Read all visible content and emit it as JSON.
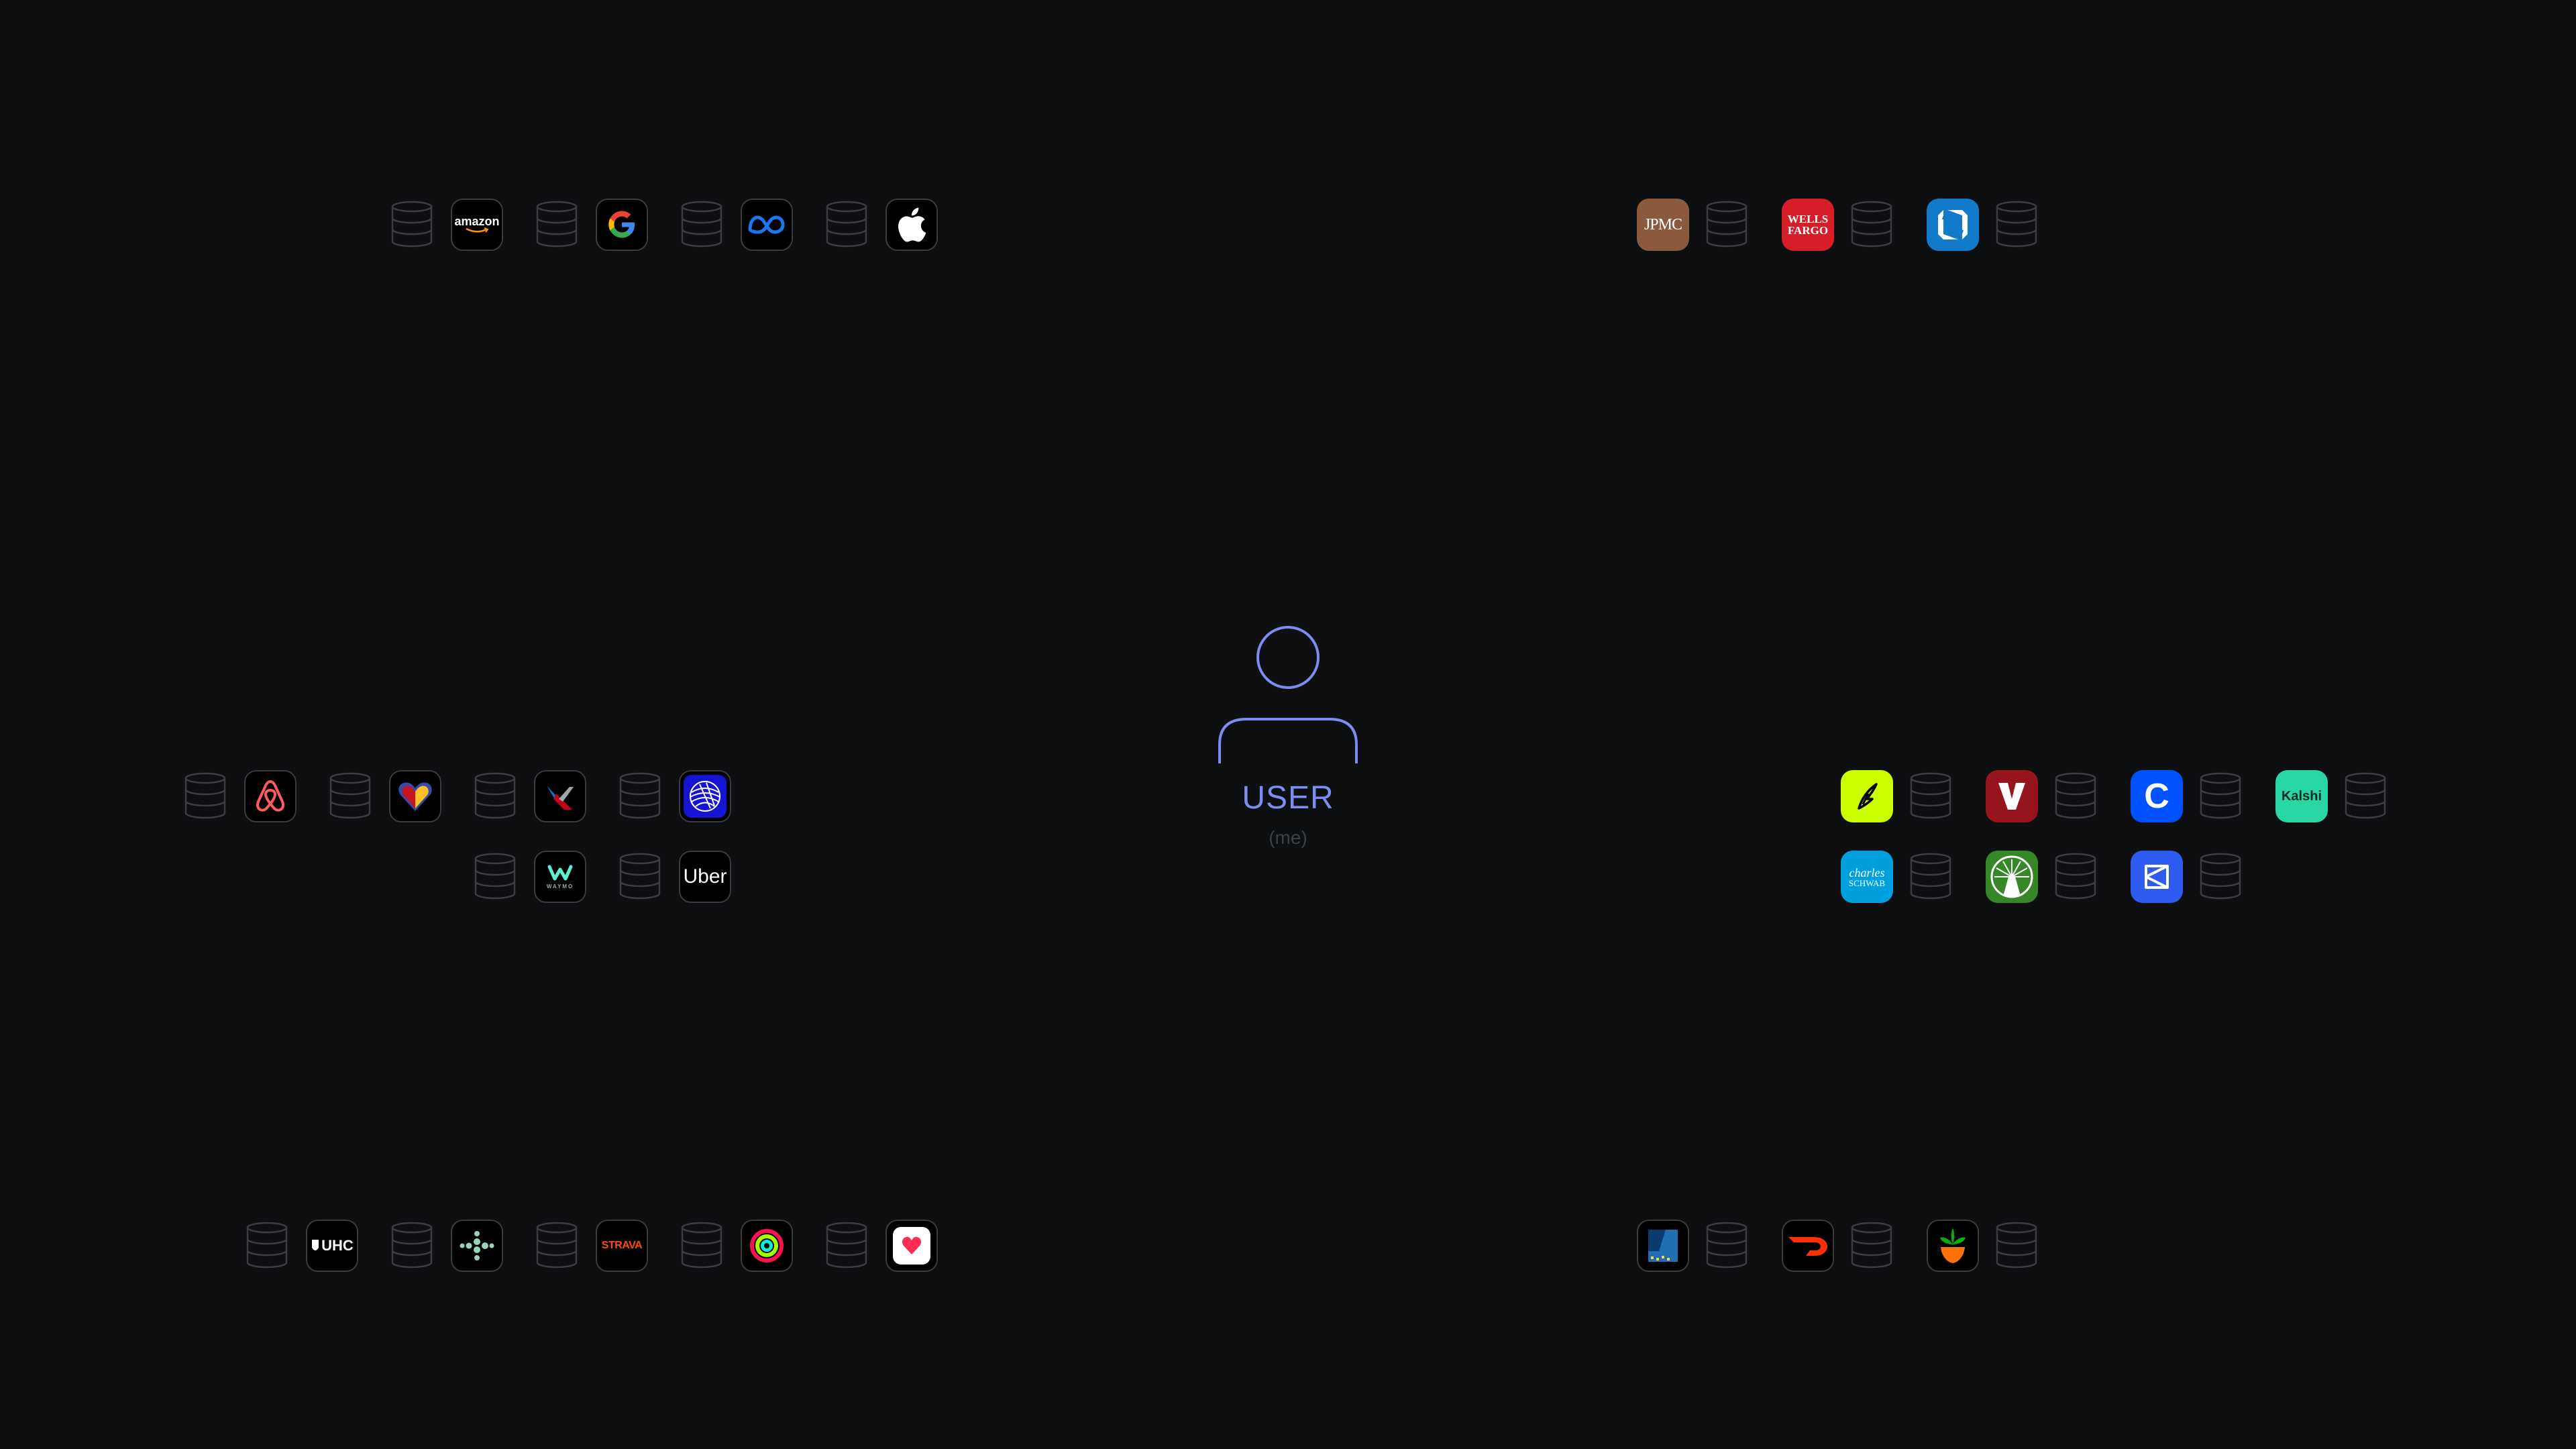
{
  "center": {
    "label": "USER",
    "sublabel": "(me)",
    "accent_color": "#7d8cf0"
  },
  "groups": {
    "tech": [
      "Amazon",
      "Google",
      "Meta",
      "Apple"
    ],
    "banks": [
      "JPMC",
      "Wells Fargo",
      "Chase"
    ],
    "travel": [
      "Airbnb",
      "Southwest",
      "American Airlines",
      "United",
      "Waymo",
      "Uber"
    ],
    "finance": [
      "Robinhood",
      "Vanguard",
      "Coinbase",
      "Kalshi",
      "Charles Schwab",
      "Fidelity",
      "Crypto.com"
    ],
    "health": [
      "UHC",
      "Fitbit",
      "Strava",
      "Apple Activity",
      "Apple Health"
    ],
    "commerce": [
      "Costco",
      "DoorDash",
      "Instacart"
    ]
  },
  "logo_text": {
    "amazon": "amazon",
    "jpmc": "JPMC",
    "wells_fargo_1": "WELLS",
    "wells_fargo_2": "FARGO",
    "kalshi": "Kalshi",
    "schwab_1": "charles",
    "schwab_2": "SCHWAB",
    "uhc": "UHC",
    "strava": "STRAVA",
    "uber": "Uber",
    "waymo": "WAYMO"
  },
  "icons": {
    "database": "database-icon",
    "user": "user-icon"
  },
  "colors": {
    "background": "#0e0f11",
    "database_stroke": "#3b3d42"
  }
}
